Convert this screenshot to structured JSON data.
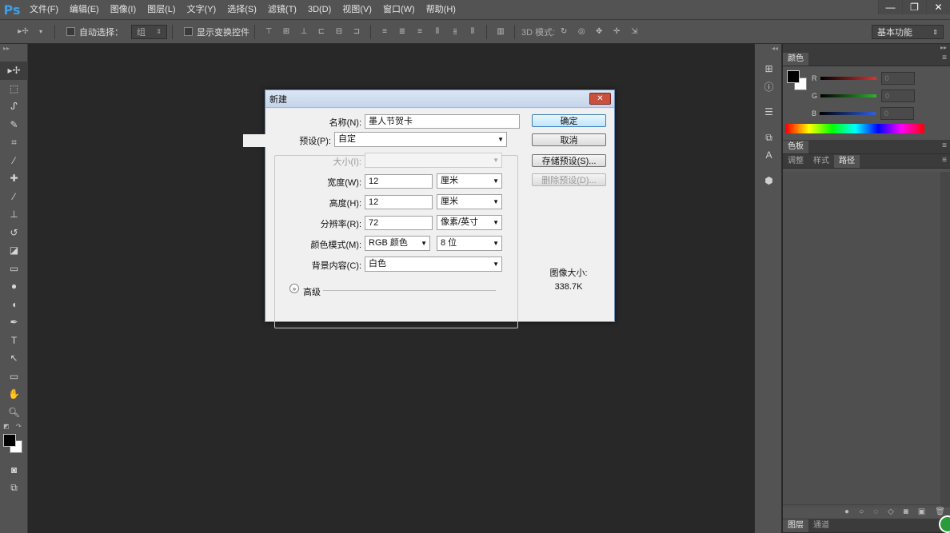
{
  "app": {
    "logo": "Ps"
  },
  "menu": [
    "文件(F)",
    "编辑(E)",
    "图像(I)",
    "图层(L)",
    "文字(Y)",
    "选择(S)",
    "滤镜(T)",
    "3D(D)",
    "视图(V)",
    "窗口(W)",
    "帮助(H)"
  ],
  "window_controls": {
    "minimize": "—",
    "restore": "❐",
    "close": "✕"
  },
  "options": {
    "auto_select_label": "自动选择：",
    "auto_select_value": "组",
    "show_transform_label": "显示变换控件",
    "mode3d_label": "3D 模式:",
    "workspace": "基本功能"
  },
  "panels": {
    "color_tab": "颜色",
    "r_label": "R",
    "g_label": "G",
    "b_label": "B",
    "r_value": "0",
    "g_value": "0",
    "b_value": "0",
    "swatches_tab": "色板",
    "adjust_tabs": [
      "调整",
      "样式",
      "路径"
    ],
    "layers_tabs": [
      "图层",
      "通道"
    ],
    "colors": {
      "r": "#e03030",
      "g": "#30b030",
      "b": "#3060e0"
    }
  },
  "dialog": {
    "title": "新建",
    "close": "✕",
    "name_label": "名称(N):",
    "name_value": "墨人节贺卡",
    "preset_label": "预设(P):",
    "preset_value": "自定",
    "size_label": "大小(I):",
    "width_label": "宽度(W):",
    "width_value": "12",
    "width_unit": "厘米",
    "height_label": "高度(H):",
    "height_value": "12",
    "height_unit": "厘米",
    "resolution_label": "分辨率(R):",
    "resolution_value": "72",
    "resolution_unit": "像素/英寸",
    "color_mode_label": "颜色模式(M):",
    "color_mode_value": "RGB 颜色",
    "bit_depth_value": "8 位",
    "bg_label": "背景内容(C):",
    "bg_value": "白色",
    "advanced_label": "高级",
    "ok_button": "确定",
    "cancel_button": "取消",
    "save_preset_button": "存储预设(S)...",
    "delete_preset_button": "删除预设(D)...",
    "image_size_label": "图像大小:",
    "image_size_value": "338.7K"
  }
}
